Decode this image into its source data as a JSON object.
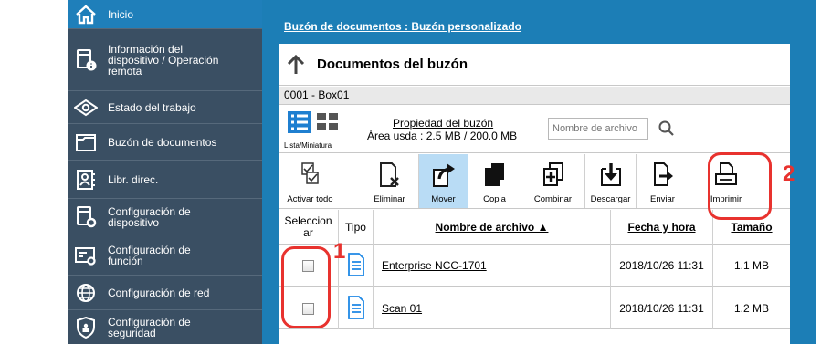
{
  "sidebar": {
    "items": [
      {
        "label": "Inicio",
        "icon": "home-icon"
      },
      {
        "label": "Información del dispositivo / Operación remota",
        "icon": "device-info-icon"
      },
      {
        "label": "Estado del trabajo",
        "icon": "eye-icon"
      },
      {
        "label": "Buzón de documentos",
        "icon": "folder-icon"
      },
      {
        "label": "Libr. direc.",
        "icon": "address-book-icon"
      },
      {
        "label": "Configuración de dispositivo",
        "icon": "device-settings-icon"
      },
      {
        "label": "Configuración de función",
        "icon": "function-settings-icon"
      },
      {
        "label": "Configuración de red",
        "icon": "globe-icon"
      },
      {
        "label": "Configuración de seguridad",
        "icon": "shield-icon"
      }
    ]
  },
  "breadcrumb": "Buzón de documentos : Buzón personalizado",
  "header": {
    "title": "Documentos del buzón"
  },
  "box": {
    "name": "0001 - Box01"
  },
  "properties": {
    "view_label": "Lista/Miniatura",
    "link": "Propiedad del buzón",
    "usage": "Área usda : 2.5 MB / 200.0 MB"
  },
  "search": {
    "placeholder": "Nombre de archivo"
  },
  "toolbar": {
    "buttons": [
      {
        "label": "Activar todo",
        "icon": "select-all-icon"
      },
      {
        "label": "Eliminar",
        "icon": "delete-icon"
      },
      {
        "label": "Mover",
        "icon": "move-icon"
      },
      {
        "label": "Copia",
        "icon": "copy-icon"
      },
      {
        "label": "Combinar",
        "icon": "merge-icon"
      },
      {
        "label": "Descargar",
        "icon": "download-icon"
      },
      {
        "label": "Enviar",
        "icon": "send-icon"
      },
      {
        "label": "Imprimir",
        "icon": "print-icon"
      }
    ]
  },
  "table": {
    "headers": {
      "select": "Seleccion ar",
      "type": "Tipo",
      "name": "Nombre de archivo ▲",
      "date": "Fecha y hora",
      "size": "Tamaño"
    },
    "rows": [
      {
        "name": "Enterprise NCC-1701",
        "date": "2018/10/26 11:31",
        "size": "1.1 MB"
      },
      {
        "name": "Scan 01",
        "date": "2018/10/26 11:31",
        "size": "1.2 MB"
      }
    ]
  },
  "annotations": {
    "callout_1": "1",
    "callout_2": "2"
  },
  "colors": {
    "sidebar": "#3a4f63",
    "accent": "#1c7eb6",
    "highlight": "#e8322e"
  }
}
